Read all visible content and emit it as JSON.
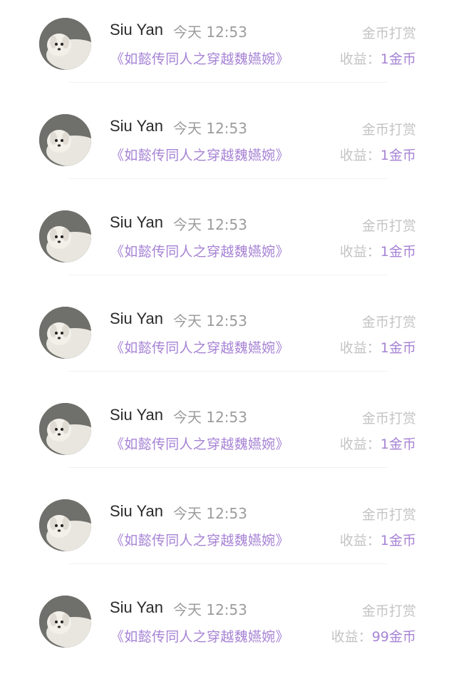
{
  "colors": {
    "accent": "#a683d4",
    "muted": "#c4c4c4",
    "name": "#2a2a2a",
    "time": "#9c9c9c"
  },
  "rows": [
    {
      "avatar_icon": "dog-avatar-icon",
      "name": "Siu Yan",
      "time": "今天 12:53",
      "title": "《如懿传同人之穿越魏嬿婉》",
      "reward_label": "金币打赏",
      "earnings_label": "收益：",
      "earnings_value": "1金币"
    },
    {
      "avatar_icon": "dog-avatar-icon",
      "name": "Siu Yan",
      "time": "今天 12:53",
      "title": "《如懿传同人之穿越魏嬿婉》",
      "reward_label": "金币打赏",
      "earnings_label": "收益：",
      "earnings_value": "1金币"
    },
    {
      "avatar_icon": "dog-avatar-icon",
      "name": "Siu Yan",
      "time": "今天 12:53",
      "title": "《如懿传同人之穿越魏嬿婉》",
      "reward_label": "金币打赏",
      "earnings_label": "收益：",
      "earnings_value": "1金币"
    },
    {
      "avatar_icon": "dog-avatar-icon",
      "name": "Siu Yan",
      "time": "今天 12:53",
      "title": "《如懿传同人之穿越魏嬿婉》",
      "reward_label": "金币打赏",
      "earnings_label": "收益：",
      "earnings_value": "1金币"
    },
    {
      "avatar_icon": "dog-avatar-icon",
      "name": "Siu Yan",
      "time": "今天 12:53",
      "title": "《如懿传同人之穿越魏嬿婉》",
      "reward_label": "金币打赏",
      "earnings_label": "收益：",
      "earnings_value": "1金币"
    },
    {
      "avatar_icon": "dog-avatar-icon",
      "name": "Siu Yan",
      "time": "今天 12:53",
      "title": "《如懿传同人之穿越魏嬿婉》",
      "reward_label": "金币打赏",
      "earnings_label": "收益：",
      "earnings_value": "1金币"
    },
    {
      "avatar_icon": "dog-avatar-icon",
      "name": "Siu Yan",
      "time": "今天 12:53",
      "title": "《如懿传同人之穿越魏嬿婉》",
      "reward_label": "金币打赏",
      "earnings_label": "收益：",
      "earnings_value": "99金币"
    }
  ]
}
